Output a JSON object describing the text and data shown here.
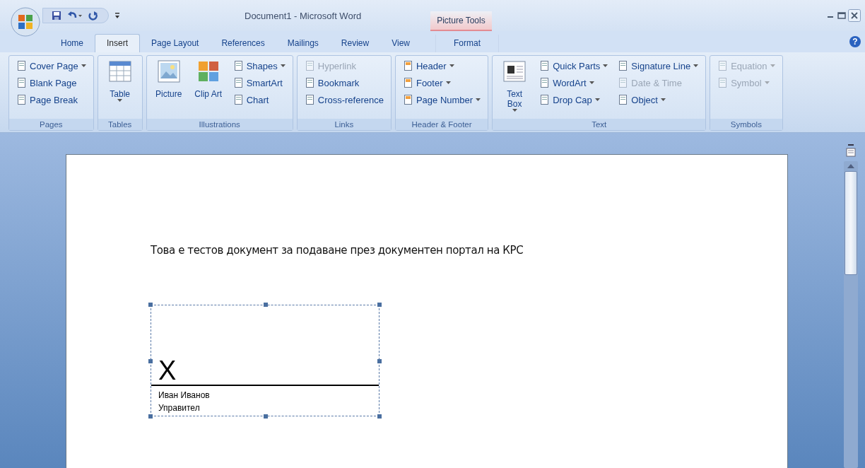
{
  "window": {
    "title": "Document1  - Microsoft Word",
    "context_label": "Picture Tools",
    "help_glyph": "?"
  },
  "tabs": [
    {
      "label": "Home",
      "selected": false,
      "kind": "normal"
    },
    {
      "label": "Insert",
      "selected": true,
      "kind": "normal"
    },
    {
      "label": "Page Layout",
      "selected": false,
      "kind": "normal"
    },
    {
      "label": "References",
      "selected": false,
      "kind": "normal"
    },
    {
      "label": "Mailings",
      "selected": false,
      "kind": "normal"
    },
    {
      "label": "Review",
      "selected": false,
      "kind": "normal"
    },
    {
      "label": "View",
      "selected": false,
      "kind": "normal"
    },
    {
      "label": "Format",
      "selected": false,
      "kind": "contextual"
    }
  ],
  "ribbon": [
    {
      "label": "Pages",
      "items": [
        {
          "kind": "small",
          "label": "Cover Page",
          "dropdown": true,
          "disabled": false
        },
        {
          "kind": "small",
          "label": "Blank Page",
          "dropdown": false,
          "disabled": false
        },
        {
          "kind": "small",
          "label": "Page Break",
          "dropdown": false,
          "disabled": false
        }
      ]
    },
    {
      "label": "Tables",
      "items": [
        {
          "kind": "large",
          "label": "Table",
          "dropdown": true,
          "disabled": false
        }
      ]
    },
    {
      "label": "Illustrations",
      "items": [
        {
          "kind": "large",
          "label": "Picture",
          "dropdown": false,
          "disabled": false
        },
        {
          "kind": "large",
          "label": "Clip Art",
          "dropdown": false,
          "disabled": false
        },
        {
          "kind": "small",
          "label": "Shapes",
          "dropdown": true,
          "disabled": false
        },
        {
          "kind": "small",
          "label": "SmartArt",
          "dropdown": false,
          "disabled": false
        },
        {
          "kind": "small",
          "label": "Chart",
          "dropdown": false,
          "disabled": false
        }
      ]
    },
    {
      "label": "Links",
      "items": [
        {
          "kind": "small",
          "label": "Hyperlink",
          "dropdown": false,
          "disabled": true
        },
        {
          "kind": "small",
          "label": "Bookmark",
          "dropdown": false,
          "disabled": false
        },
        {
          "kind": "small",
          "label": "Cross-reference",
          "dropdown": false,
          "disabled": false
        }
      ]
    },
    {
      "label": "Header & Footer",
      "items": [
        {
          "kind": "small",
          "label": "Header",
          "dropdown": true,
          "disabled": false
        },
        {
          "kind": "small",
          "label": "Footer",
          "dropdown": true,
          "disabled": false
        },
        {
          "kind": "small",
          "label": "Page Number",
          "dropdown": true,
          "disabled": false
        }
      ]
    },
    {
      "label": "Text",
      "items": [
        {
          "kind": "large",
          "label": "Text Box",
          "dropdown": true,
          "disabled": false
        },
        {
          "kind": "small",
          "label": "Quick Parts",
          "dropdown": true,
          "disabled": false
        },
        {
          "kind": "small",
          "label": "WordArt",
          "dropdown": true,
          "disabled": false
        },
        {
          "kind": "small",
          "label": "Drop Cap",
          "dropdown": true,
          "disabled": false
        },
        {
          "kind": "small",
          "label": "Signature Line",
          "dropdown": true,
          "disabled": false
        },
        {
          "kind": "small",
          "label": "Date & Time",
          "dropdown": false,
          "disabled": true
        },
        {
          "kind": "small",
          "label": "Object",
          "dropdown": true,
          "disabled": false
        }
      ]
    },
    {
      "label": "Symbols",
      "items": [
        {
          "kind": "small",
          "label": "Equation",
          "dropdown": true,
          "disabled": true
        },
        {
          "kind": "small",
          "label": "Symbol",
          "dropdown": true,
          "disabled": true
        }
      ]
    }
  ],
  "document": {
    "paragraph": "Това е тестов документ за подаване през документен портал на КРС",
    "signature": {
      "mark": "X",
      "name": "Иван Иванов",
      "title": "Управител",
      "selected": true
    }
  }
}
